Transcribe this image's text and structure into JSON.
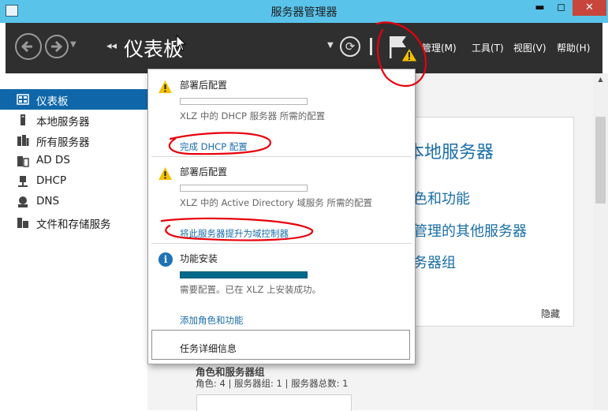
{
  "window": {
    "title": "服务器管理器",
    "minimize": "▬",
    "maximize": "◻",
    "close": "✕"
  },
  "toolbar": {
    "page_title": "仪表板",
    "breadcrumb_arrows": "◂◂",
    "refresh_glyph": "⟳",
    "menus": [
      {
        "label": "管理(M)"
      },
      {
        "label": "工具(T)"
      },
      {
        "label": "视图(V)"
      },
      {
        "label": "帮助(H)"
      }
    ]
  },
  "sidebar": {
    "items": [
      {
        "label": "仪表板",
        "icon": "dashboard-icon",
        "active": true
      },
      {
        "label": "本地服务器",
        "icon": "local-server-icon"
      },
      {
        "label": "所有服务器",
        "icon": "all-servers-icon"
      },
      {
        "label": "AD DS",
        "icon": "ad-ds-icon"
      },
      {
        "label": "DHCP",
        "icon": "dhcp-icon"
      },
      {
        "label": "DNS",
        "icon": "dns-icon"
      },
      {
        "label": "文件和存储服务",
        "icon": "file-storage-icon"
      }
    ]
  },
  "main": {
    "heading": "本地服务器",
    "links": [
      "色和功能",
      "管理的其他服务器",
      "务器组"
    ],
    "hide": "隐藏",
    "roles_title": "角色和服务器组",
    "roles_counts": "角色: 4 | 服务器组: 1 | 服务器总数: 1"
  },
  "notifications": {
    "items": [
      {
        "icon": "warning-icon",
        "title": "部署后配置",
        "progress": 0,
        "description": "XLZ 中的 DHCP 服务器 所需的配置",
        "link": "完成 DHCP 配置"
      },
      {
        "icon": "warning-icon",
        "title": "部署后配置",
        "progress": 0,
        "description": "XLZ 中的 Active Directory 域服务 所需的配置",
        "link": "将此服务器提升为域控制器"
      },
      {
        "icon": "info-icon",
        "info_glyph": "i",
        "title": "功能安装",
        "progress": 1,
        "description": "需要配置。已在 XLZ 上安装成功。",
        "link": "添加角色和功能"
      }
    ],
    "task_details": "任务详细信息"
  },
  "colors": {
    "titlebar": "#5ac3ea",
    "toolbar": "#2f2f2f",
    "sidebar_active": "#0f67a9",
    "link": "#1a6ea8",
    "annotation": "#e8000b",
    "warning": "#f5c000"
  }
}
